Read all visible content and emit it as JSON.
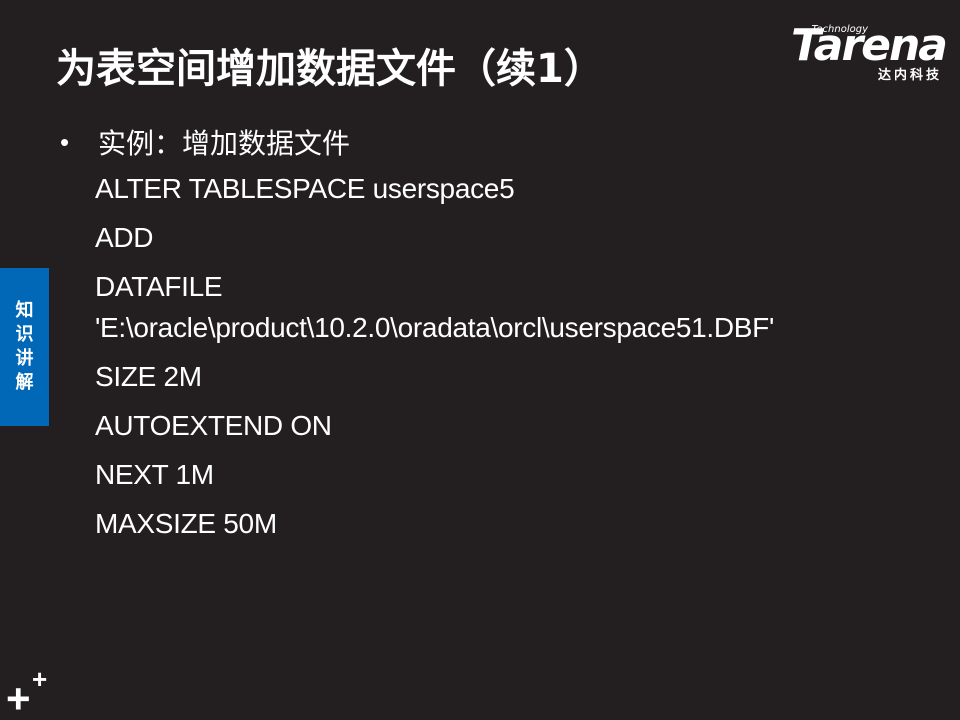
{
  "slide": {
    "title": "为表空间增加数据文件（续1）",
    "bullet": "实例：增加数据文件",
    "code_lines": [
      "ALTER TABLESPACE userspace5",
      "ADD",
      "DATAFILE",
      "'E:\\oracle\\product\\10.2.0\\oradata\\orcl\\userspace51.DBF'",
      "SIZE  2M",
      "AUTOEXTEND ON",
      "NEXT  1M",
      "MAXSIZE  50M"
    ]
  },
  "logo": {
    "tech": "Technology",
    "word": "Tarena",
    "sub": "达内科技"
  },
  "side_tab": [
    "知",
    "识",
    "讲",
    "解"
  ],
  "decor": {
    "plus_big": "+",
    "plus_small": "+"
  },
  "colors": {
    "background": "#231f20",
    "tab_blue": "#0068b7",
    "text": "#ffffff"
  }
}
